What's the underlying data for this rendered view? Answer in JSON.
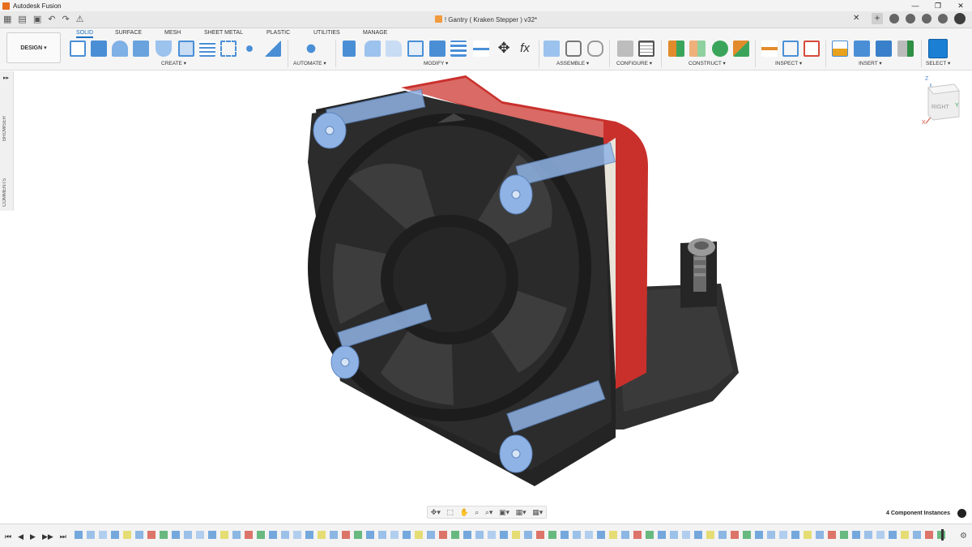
{
  "window": {
    "title": "Autodesk Fusion",
    "controls": [
      "—",
      "❐",
      "✕"
    ]
  },
  "document": {
    "tab_title": "! Gantry ( Kraken Stepper ) v32*",
    "close_glyph": "✕"
  },
  "quick_access": {
    "grid_glyph": "▦",
    "file_glyph": "▤",
    "save_glyph": "▣",
    "undo_glyph": "↶",
    "redo_glyph": "↷",
    "warning_glyph": "⚠"
  },
  "ribbon": {
    "workspace_button": "DESIGN ▾",
    "tabs": [
      {
        "label": "SOLID",
        "active": true
      },
      {
        "label": "SURFACE"
      },
      {
        "label": "MESH"
      },
      {
        "label": "SHEET METAL"
      },
      {
        "label": "PLASTIC"
      },
      {
        "label": "UTILITIES"
      },
      {
        "label": "MANAGE"
      }
    ],
    "groups": [
      {
        "label": "CREATE ▾"
      },
      {
        "label": "AUTOMATE ▾"
      },
      {
        "label": "MODIFY ▾"
      },
      {
        "label": "ASSEMBLE ▾"
      },
      {
        "label": "CONFIGURE ▾"
      },
      {
        "label": "CONSTRUCT ▾"
      },
      {
        "label": "INSPECT ▾"
      },
      {
        "label": "INSERT ▾"
      },
      {
        "label": "SELECT ▾"
      }
    ],
    "colors": {
      "accent": "#1b6ec2",
      "tool_blue": "#4a8fd6",
      "tool_green": "#3aa55a",
      "tool_orange": "#e28b2c",
      "tool_red": "#d64a3b"
    }
  },
  "side_panel": {
    "expand_glyph": "▸▸",
    "browser_label": "BROWSER",
    "comments_label": "COMMENTS"
  },
  "viewcube": {
    "face_label": "RIGHT",
    "axis_z": "Z",
    "axis_y": "Y",
    "axis_x": "X"
  },
  "status": {
    "component_instances": "4 Component Instances"
  },
  "navbar": {
    "items": [
      "✥▾",
      "⬚",
      "✋",
      "⌕",
      "⌕▾",
      "▣▾",
      "▦▾",
      "▦▾"
    ]
  },
  "timeline": {
    "controls": [
      "⏮",
      "◀",
      "▶",
      "▶▶",
      "⏭"
    ],
    "gear_glyph": "⚙"
  },
  "model": {
    "colors": {
      "fan_body": "#2a2a2a",
      "fan_dark": "#1a1a1a",
      "shroud_red": "#c9302c",
      "bolt_blue": "#8fb3e4",
      "base": "#303030"
    }
  }
}
